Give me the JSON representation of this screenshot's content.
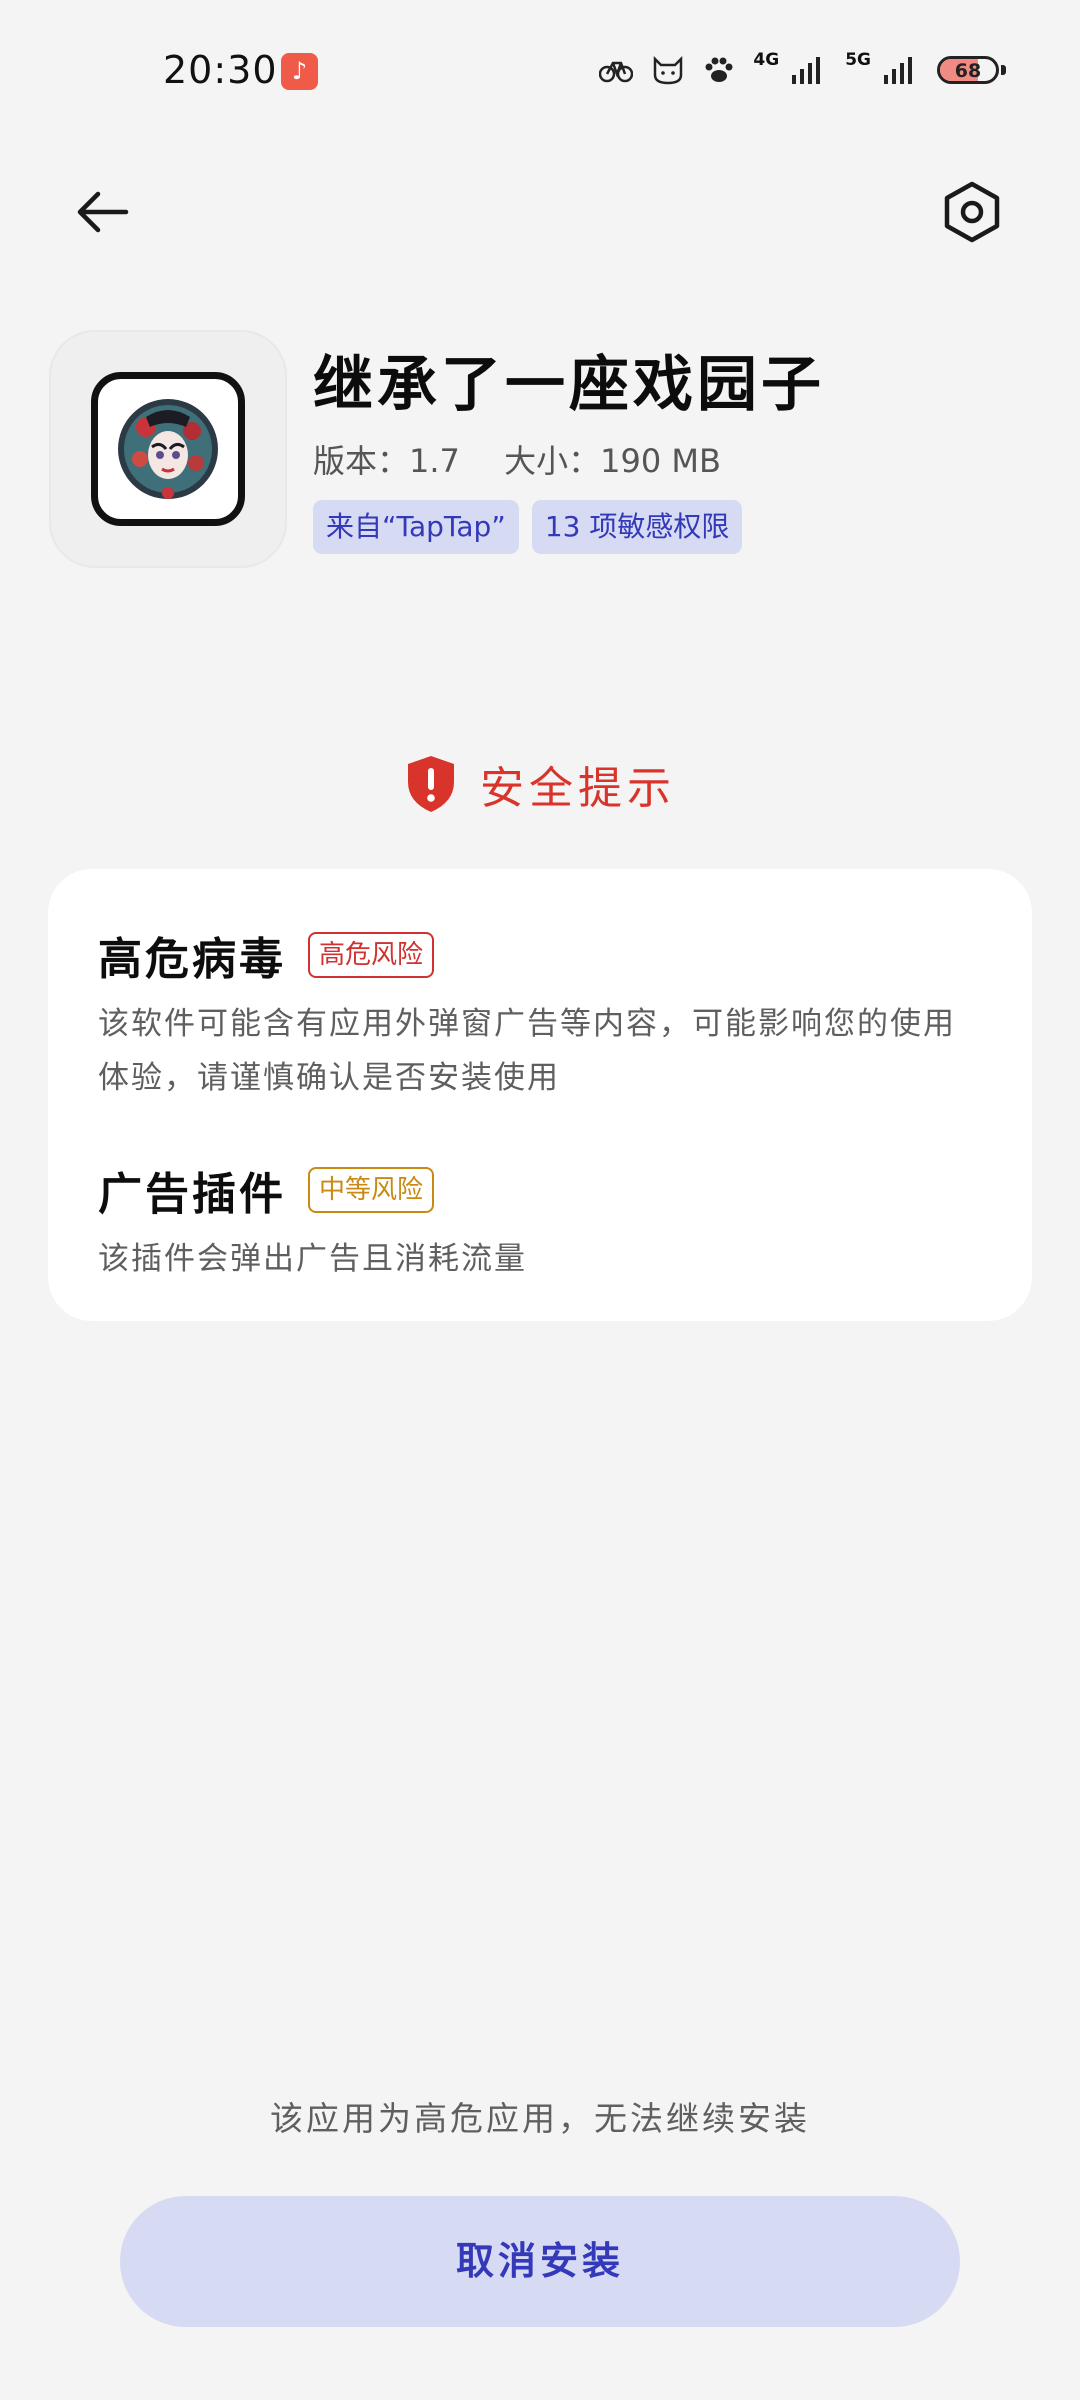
{
  "status_bar": {
    "time": "20:30",
    "music_icon": "music-note-icon",
    "sim_labels": [
      "4G",
      "5G"
    ],
    "battery_level": "68",
    "battery_fraction": 0.68
  },
  "nav": {
    "back_icon": "arrow-left-icon",
    "settings_icon": "hexagon-settings-icon"
  },
  "app": {
    "name": "继承了一座戏园子",
    "version_label": "版本：",
    "version": "1.7",
    "size_label": "大小：",
    "size": "190 MB",
    "source_chip": "来自“TapTap”",
    "permissions_chip": "13 项敏感权限"
  },
  "safety": {
    "title": "安全提示",
    "icon": "shield-alert-icon",
    "items": [
      {
        "name": "高危病毒",
        "tag": "高危风险",
        "description": "该软件可能含有应用外弹窗广告等内容，可能影响您的使用体验，请谨慎确认是否安装使用"
      },
      {
        "name": "广告插件",
        "tag": "中等风险",
        "description": "该插件会弹出广告且消耗流量"
      }
    ]
  },
  "footer": {
    "note": "该应用为高危应用，无法继续安装",
    "cancel_label": "取消安装"
  },
  "colors": {
    "background": "#f4f4f4",
    "accent": "#3339b8",
    "accent_bg": "#d7daf3",
    "danger": "#d9342b",
    "warning": "#c98a13"
  }
}
